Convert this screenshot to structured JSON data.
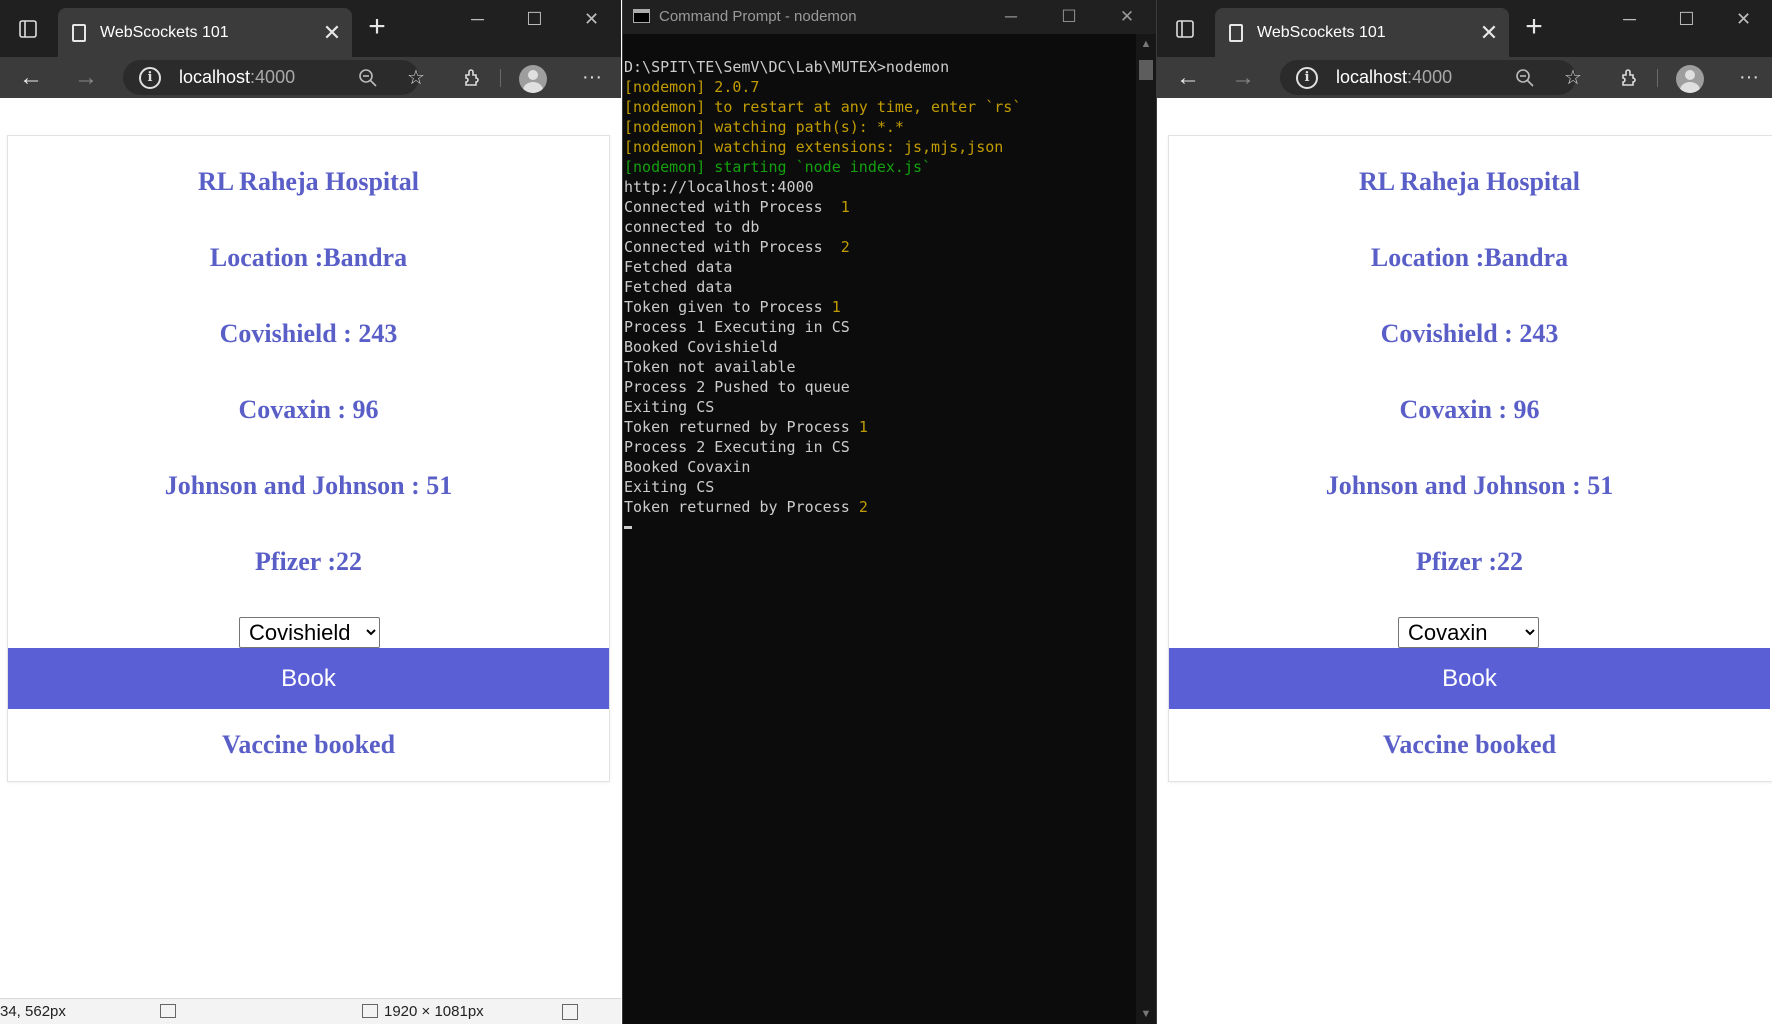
{
  "browser": {
    "tab_title": "WebScockets 101",
    "tab_close": "✕",
    "new_tab": "+",
    "url_host": "localhost",
    "url_port": ":4000"
  },
  "hospital": {
    "name": "RL Raheja Hospital",
    "location": "Location :Bandra",
    "covishield": "Covishield : 243",
    "covaxin": "Covaxin : 96",
    "jnj": "Johnson and Johnson : 51",
    "pfizer": "Pfizer :22",
    "book_label": "Book",
    "status": "Vaccine booked"
  },
  "left": {
    "selected": "Covishield"
  },
  "right": {
    "selected": "Covaxin"
  },
  "vaccine_options": [
    "Covishield",
    "Covaxin",
    "Johnson and Johnson",
    "Pfizer"
  ],
  "statusbar": {
    "coords": "34, 562px",
    "dimensions": "1920 × 1081px"
  },
  "terminal": {
    "title": "Command Prompt - nodemon",
    "lines": [
      {
        "text": "D:\\SPIT\\TE\\SemV\\DC\\Lab\\MUTEX>nodemon",
        "color": "w"
      },
      {
        "text": "[nodemon] 2.0.7",
        "color": "y"
      },
      {
        "text": "[nodemon] to restart at any time, enter `rs`",
        "color": "y"
      },
      {
        "text": "[nodemon] watching path(s): *.*",
        "color": "y"
      },
      {
        "text": "[nodemon] watching extensions: js,mjs,json",
        "color": "y"
      },
      {
        "text": "[nodemon] starting `node index.js`",
        "color": "g"
      },
      {
        "text": "http://localhost:4000",
        "color": "w"
      },
      {
        "text": "Connected with Process  ",
        "num": "1",
        "color": "w"
      },
      {
        "text": "connected to db",
        "color": "w"
      },
      {
        "text": "Connected with Process  ",
        "num": "2",
        "color": "w"
      },
      {
        "text": "Fetched data",
        "color": "w"
      },
      {
        "text": "Fetched data",
        "color": "w"
      },
      {
        "text": "Token given to Process ",
        "num": "1",
        "color": "w"
      },
      {
        "text": "Process 1 Executing in CS",
        "color": "w"
      },
      {
        "text": "Booked Covishield",
        "color": "w"
      },
      {
        "text": "Token not available",
        "color": "w"
      },
      {
        "text": "Process 2 Pushed to queue",
        "color": "w"
      },
      {
        "text": "Exiting CS",
        "color": "w"
      },
      {
        "text": "Token returned by Process ",
        "num": "1",
        "color": "w"
      },
      {
        "text": "Process 2 Executing in CS",
        "color": "w"
      },
      {
        "text": "Booked Covaxin",
        "color": "w"
      },
      {
        "text": "Exiting CS",
        "color": "w"
      },
      {
        "text": "Token returned by Process ",
        "num": "2",
        "color": "w"
      }
    ]
  },
  "colors": {
    "accent": "#5a5fd6",
    "heading": "#5a5fc8",
    "term_yellow": "#c19c00",
    "term_green": "#13a10e"
  }
}
